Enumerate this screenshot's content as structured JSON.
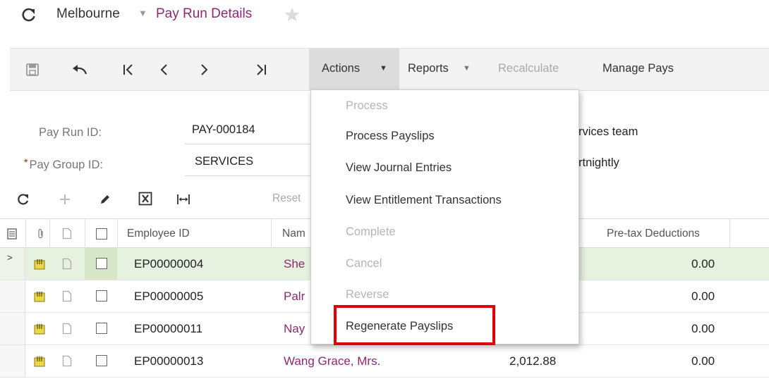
{
  "header": {
    "parent": "Melbourne",
    "title": "Pay Run Details"
  },
  "toolbar": {
    "actions_label": "Actions",
    "reports_label": "Reports",
    "recalculate_label": "Recalculate",
    "manage_pays_label": "Manage Pays"
  },
  "form": {
    "pay_run_id_label": "Pay Run ID:",
    "pay_run_id_value": "PAY-000184",
    "pay_group_id_label": "Pay Group ID:",
    "pay_group_id_value": "SERVICES",
    "description_value": "rvices team",
    "frequency_value": "rtnightly"
  },
  "grid_toolbar": {
    "reset_label": "Reset"
  },
  "table": {
    "headers": {
      "employee_id": "Employee ID",
      "name": "Nam",
      "pretax": "Pre-tax Deductions"
    },
    "rows": [
      {
        "employee_id": "EP00000004",
        "name": "She",
        "amount": "",
        "pretax": "0.00"
      },
      {
        "employee_id": "EP00000005",
        "name": "Palr",
        "amount": "",
        "pretax": "0.00"
      },
      {
        "employee_id": "EP00000011",
        "name": "Nay",
        "amount": "",
        "pretax": "0.00"
      },
      {
        "employee_id": "EP00000013",
        "name": "Wang Grace, Mrs.",
        "amount": "2,012.88",
        "pretax": "0.00"
      }
    ]
  },
  "actions_menu": {
    "items": [
      {
        "label": "Process",
        "enabled": false
      },
      {
        "label": "Process Payslips",
        "enabled": true
      },
      {
        "label": "View Journal Entries",
        "enabled": true
      },
      {
        "label": "View Entitlement Transactions",
        "enabled": true
      },
      {
        "label": "Complete",
        "enabled": false
      },
      {
        "label": "Cancel",
        "enabled": false
      },
      {
        "label": "Reverse",
        "enabled": false
      },
      {
        "label": "Regenerate Payslips",
        "enabled": true
      }
    ]
  },
  "colors": {
    "link": "#8b2a73",
    "highlight": "#e00000",
    "selected_row": "#e7f1df"
  }
}
